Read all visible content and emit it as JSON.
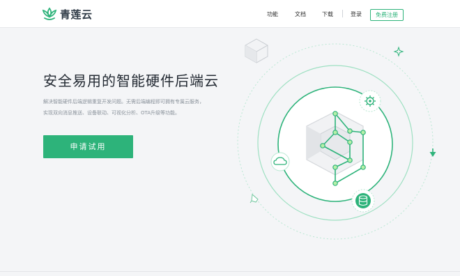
{
  "brand": {
    "name": "青莲云",
    "color": "#2db37a"
  },
  "nav": {
    "items": [
      "功能",
      "文档",
      "下载"
    ],
    "login": "登录",
    "register": "免费注册"
  },
  "hero": {
    "title": "安全易用的智能硬件后端云",
    "description_line1": "解决智能硬件后端逻辑重复开发问题。无需后端编程即可拥有专属云服务，",
    "description_line2": "实现双向消息推送、设备联动、可视化分析、OTA升级等功能。",
    "cta": "申请试用"
  },
  "illustration": {
    "icons": [
      "cube-icon",
      "gear-icon",
      "cloud-icon",
      "database-icon",
      "rocket-icon",
      "sparkle-icon",
      "arrow-down-icon",
      "hexagon-circuit-icon"
    ]
  }
}
